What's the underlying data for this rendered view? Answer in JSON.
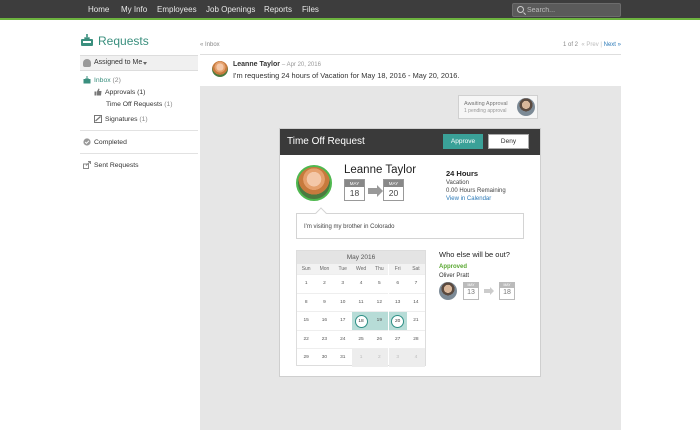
{
  "nav": {
    "items": [
      "Home",
      "My Info",
      "Employees",
      "Job Openings",
      "Reports",
      "Files"
    ],
    "search_placeholder": "Search..."
  },
  "sidebar": {
    "title": "Requests",
    "assigned_label": "Assigned to Me",
    "inbox_label": "Inbox",
    "inbox_count": "(2)",
    "approvals_label": "Approvals",
    "approvals_count": "(1)",
    "timeoff_label": "Time Off Requests",
    "timeoff_count": "(1)",
    "signatures_label": "Signatures",
    "signatures_count": "(1)",
    "completed_label": "Completed",
    "sent_label": "Sent Requests"
  },
  "header": {
    "back_label": "« Inbox",
    "pager_count": "1 of 2",
    "pager_prev": "« Prev",
    "pager_sep": "|",
    "pager_next": "Next »"
  },
  "message": {
    "sender": "Leanne Taylor",
    "date": "– Apr 20, 2016",
    "text": "I'm requesting 24 hours of Vacation for May 18, 2016 - May 20, 2016."
  },
  "awaiting": {
    "line1": "Awaiting Approval",
    "line2": "1 pending approval"
  },
  "card": {
    "title": "Time Off Request",
    "approve_label": "Approve",
    "deny_label": "Deny",
    "name": "Leanne Taylor",
    "from_month": "MAY",
    "from_day": "18",
    "to_month": "MAY",
    "to_day": "20",
    "hours": "24 Hours",
    "type": "Vacation",
    "remaining": "0.00 Hours Remaining",
    "view_calendar": "View in Calendar",
    "comment": "I'm visiting my brother in Colorado"
  },
  "calendar": {
    "title": "May 2016",
    "dow": [
      "Sun",
      "Mon",
      "Tue",
      "Wed",
      "Thu",
      "Fri",
      "Sat"
    ],
    "rows": [
      [
        "1",
        "2",
        "3",
        "4",
        "5",
        "6",
        "7"
      ],
      [
        "8",
        "9",
        "10",
        "11",
        "12",
        "13",
        "14"
      ],
      [
        "15",
        "16",
        "17",
        "18",
        "19",
        "20",
        "21"
      ],
      [
        "22",
        "23",
        "24",
        "25",
        "26",
        "27",
        "28"
      ],
      [
        "29",
        "30",
        "31",
        "1",
        "2",
        "3",
        "4"
      ]
    ],
    "range_start": "18",
    "range_end": "20",
    "range_color": "#b7dcd7",
    "marker_color": "#2e8f85"
  },
  "others": {
    "title": "Who else will be out?",
    "status": "Approved",
    "person": "Oliver Pratt",
    "from_month": "MAY",
    "from_day": "13",
    "to_month": "MAY",
    "to_day": "18"
  },
  "colors": {
    "accent": "#3a8f7e",
    "approve": "#3aa198",
    "nav_bg": "#3d3d3d",
    "approved_text": "#5aa832",
    "link": "#2c7ab8"
  }
}
